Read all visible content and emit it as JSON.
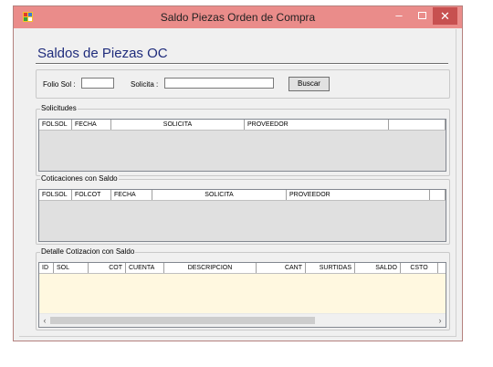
{
  "window": {
    "title": "Saldo Piezas Orden de Compra",
    "minimize_glyph": "–",
    "close_glyph": "✕"
  },
  "form": {
    "heading": "Saldos de Piezas OC"
  },
  "search": {
    "folio_label": "Folio Sol :",
    "folio_value": "",
    "solicita_label": "Solicita :",
    "solicita_value": "",
    "button_label": "Buscar"
  },
  "solicitudes": {
    "title": "Solicitudes",
    "columns": [
      "FOLSOL",
      "FECHA",
      "SOLICITA",
      "PROVEEDOR",
      ""
    ]
  },
  "cotizaciones": {
    "title": "Coticaciones con Saldo",
    "columns": [
      "FOLSOL",
      "FOLCOT",
      "FECHA",
      "SOLICITA",
      "PROVEEDOR",
      ""
    ]
  },
  "detalle": {
    "title": "Detalle Cotizacion con Saldo",
    "columns": [
      "ID",
      "SOL",
      "COT",
      "CUENTA",
      "DESCRIPCION",
      "CANT",
      "SURTIDAS",
      "SALDO",
      "CSTO"
    ],
    "scroll_left_glyph": "‹",
    "scroll_right_glyph": "›"
  },
  "colors": {
    "titlebar": "#ea8c8a",
    "close_button": "#c75050",
    "heading": "#1f2c7c",
    "detail_background": "#fff8e0"
  },
  "icons": [
    "app-icon",
    "minimize-icon",
    "maximize-icon",
    "close-icon",
    "scroll-left-icon",
    "scroll-right-icon"
  ]
}
